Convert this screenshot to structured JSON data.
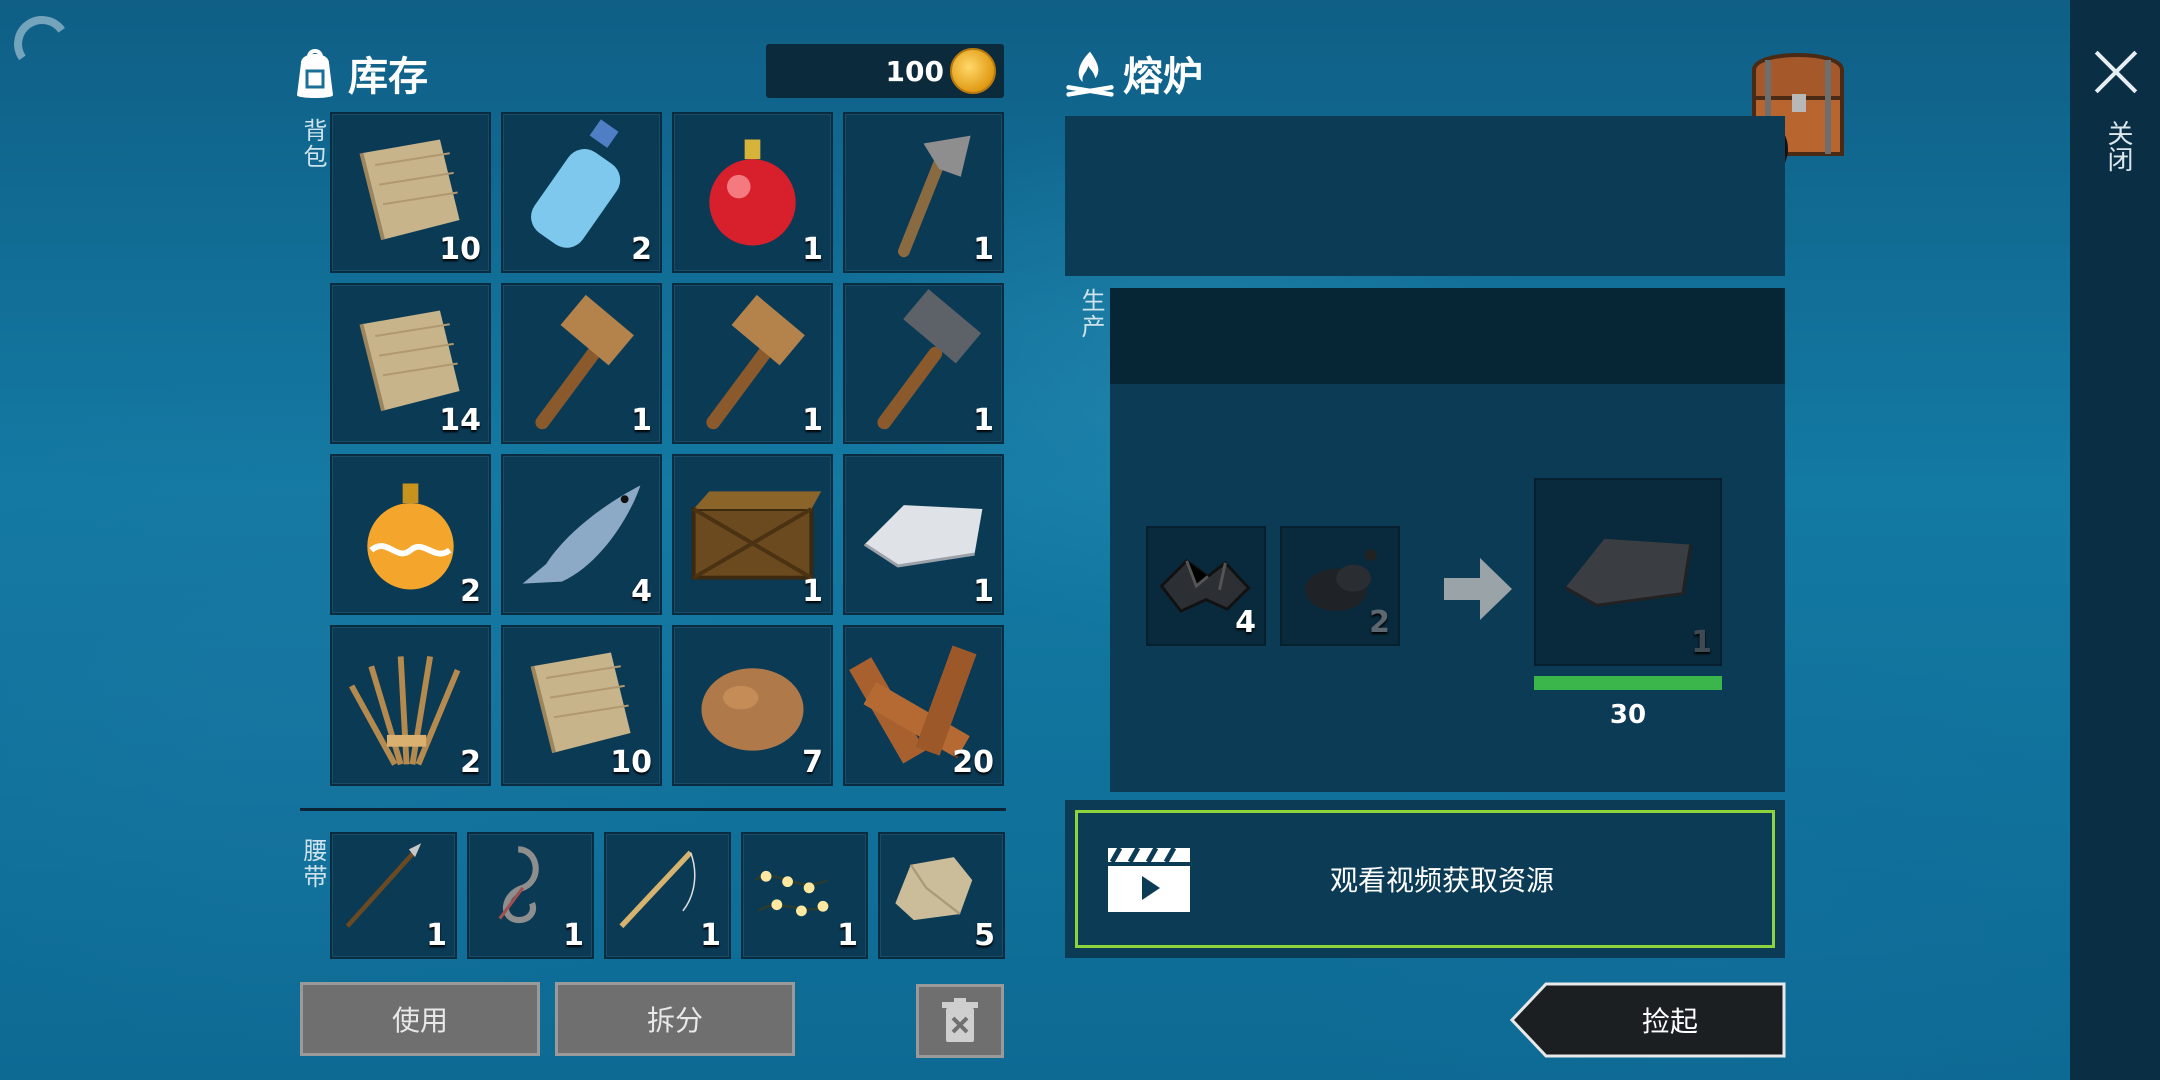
{
  "inventory": {
    "title": "库存",
    "coins": "100",
    "backpack_label": "背包",
    "belt_label": "腰带",
    "backpack": [
      {
        "item": "cloth-icon",
        "qty": "10"
      },
      {
        "item": "water-bottle-icon",
        "qty": "2"
      },
      {
        "item": "red-bauble-icon",
        "qty": "1"
      },
      {
        "item": "stone-axe-icon",
        "qty": "1"
      },
      {
        "item": "cloth-icon",
        "qty": "14"
      },
      {
        "item": "wooden-hammer-icon",
        "qty": "1"
      },
      {
        "item": "wooden-hammer-icon",
        "qty": "1"
      },
      {
        "item": "metal-hammer-icon",
        "qty": "1"
      },
      {
        "item": "gold-bauble-icon",
        "qty": "2"
      },
      {
        "item": "fish-icon",
        "qty": "4"
      },
      {
        "item": "wooden-crate-icon",
        "qty": "1"
      },
      {
        "item": "metal-ingot-icon",
        "qty": "1"
      },
      {
        "item": "thatch-icon",
        "qty": "2"
      },
      {
        "item": "cloth-icon",
        "qty": "10"
      },
      {
        "item": "clay-icon",
        "qty": "7"
      },
      {
        "item": "planks-icon",
        "qty": "20"
      }
    ],
    "belt": [
      {
        "item": "spear-icon",
        "qty": "1"
      },
      {
        "item": "hook-icon",
        "qty": "1"
      },
      {
        "item": "fishing-rod-icon",
        "qty": "1"
      },
      {
        "item": "string-lights-icon",
        "qty": "1"
      },
      {
        "item": "stone-icon",
        "qty": "5"
      }
    ],
    "use_label": "使用",
    "split_label": "拆分"
  },
  "furnace": {
    "title": "熔炉",
    "production_label": "生产",
    "inputs": [
      {
        "item": "metal-ore-icon",
        "qty": "4"
      },
      {
        "item": "coal-icon",
        "qty": "2"
      }
    ],
    "output": {
      "item": "ingot-icon",
      "qty": "1"
    },
    "progress_fraction": 1.0,
    "timer": "30",
    "video_label": "观看视频获取资源",
    "pickup_label": "捡起"
  },
  "sidebar": {
    "close_label": "关闭"
  },
  "colors": {
    "progress": "#3bb64a",
    "video_border": "#8ed33c",
    "panel": "#0c3b56"
  }
}
